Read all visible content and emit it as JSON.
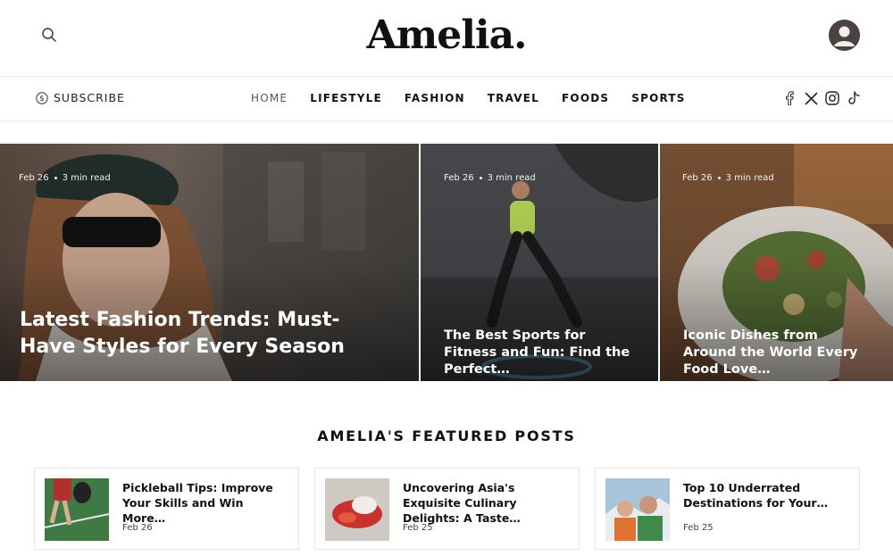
{
  "header": {
    "logo": "Amelia.",
    "search_icon": "search-icon",
    "account_icon": "user-avatar-icon"
  },
  "nav": {
    "subscribe_label": "SUBSCRIBE",
    "subscribe_icon": "dollar-circle-icon",
    "links": [
      "HOME",
      "LIFESTYLE",
      "FASHION",
      "TRAVEL",
      "FOODS",
      "SPORTS"
    ],
    "active": "HOME",
    "socials": [
      "facebook-icon",
      "x-icon",
      "instagram-icon",
      "tiktok-icon"
    ]
  },
  "hero": [
    {
      "date": "Feb 26",
      "read_time": "3 min read",
      "title": "Latest Fashion Trends: Must-Have Styles for Every Season"
    },
    {
      "date": "Feb 26",
      "read_time": "3 min read",
      "title": "The Best Sports for Fitness and Fun: Find the Perfect…"
    },
    {
      "date": "Feb 26",
      "read_time": "3 min read",
      "title": "Iconic Dishes from Around the World Every Food Love…"
    }
  ],
  "featured": {
    "heading": "AMELIA'S FEATURED POSTS",
    "posts": [
      {
        "title": "Pickleball Tips: Improve Your Skills and Win More…",
        "date": "Feb 26"
      },
      {
        "title": "Uncovering Asia's Exquisite Culinary Delights: A Taste…",
        "date": "Feb 25"
      },
      {
        "title": "Top 10 Underrated Destinations for Your…",
        "date": "Feb 25"
      }
    ]
  },
  "colors": {
    "text": "#111111",
    "muted": "#555555",
    "border": "#ececec"
  }
}
